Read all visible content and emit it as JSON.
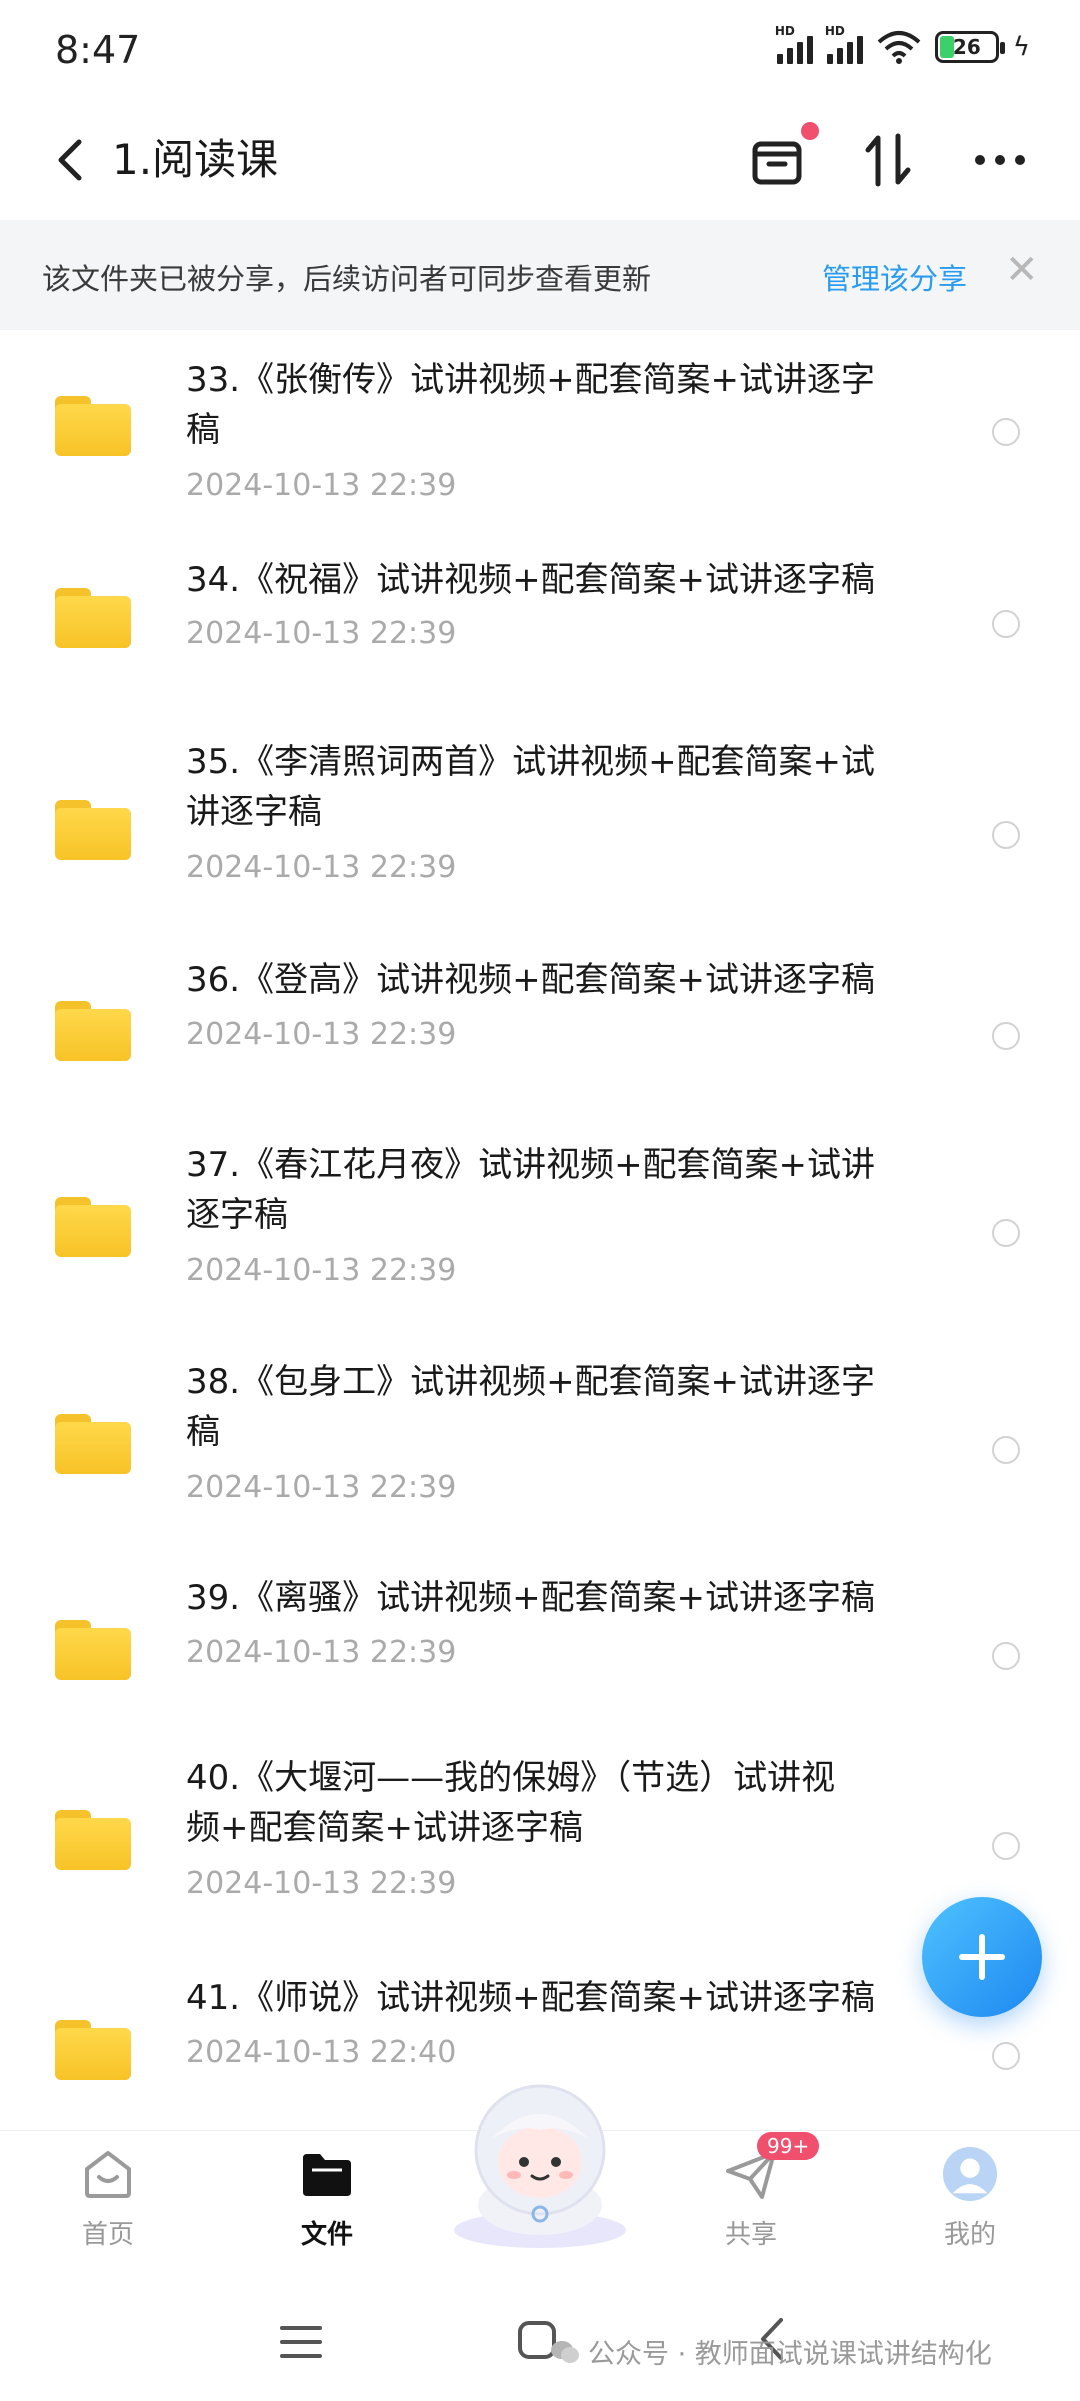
{
  "status_bar": {
    "time": "8:47",
    "battery": "26"
  },
  "header": {
    "title": "1.阅读课"
  },
  "banner": {
    "text": "该文件夹已被分享，后续访问者可同步查看更新",
    "link": "管理该分享",
    "close": "✕"
  },
  "files": [
    {
      "title_line1": "33.《张衡传》试讲视频+配套简案+试讲逐字",
      "title_line2": "稿",
      "date": "2024-10-13  22:39"
    },
    {
      "title_line1": "34.《祝福》试讲视频+配套简案+试讲逐字稿",
      "title_line2": "",
      "date": "2024-10-13  22:39"
    },
    {
      "title_line1": "35.《李清照词两首》试讲视频+配套简案+试",
      "title_line2": "讲逐字稿",
      "date": "2024-10-13  22:39"
    },
    {
      "title_line1": "36.《登高》试讲视频+配套简案+试讲逐字稿",
      "title_line2": "",
      "date": "2024-10-13  22:39"
    },
    {
      "title_line1": "37.《春江花月夜》试讲视频+配套简案+试讲",
      "title_line2": "逐字稿",
      "date": "2024-10-13  22:39"
    },
    {
      "title_line1": "38.《包身工》试讲视频+配套简案+试讲逐字",
      "title_line2": "稿",
      "date": "2024-10-13  22:39"
    },
    {
      "title_line1": "39.《离骚》试讲视频+配套简案+试讲逐字稿",
      "title_line2": "",
      "date": "2024-10-13  22:39"
    },
    {
      "title_line1": "40.《大堰河——我的保姆》（节选）试讲视",
      "title_line2": "频+配套简案+试讲逐字稿",
      "date": "2024-10-13  22:39"
    },
    {
      "title_line1": "41.《师说》试讲视频+配套简案+试讲逐字稿",
      "title_line2": "",
      "date": "2024-10-13  22:40"
    }
  ],
  "bottom_nav": {
    "home": "首页",
    "files": "文件",
    "share": "共享",
    "share_badge": "99+",
    "mine": "我的"
  },
  "watermark": "公众号 · 教师面试说课试讲结构化",
  "colors": {
    "accent": "#2a9cf0",
    "folder": "#f7c327",
    "badge": "#f0506e"
  }
}
